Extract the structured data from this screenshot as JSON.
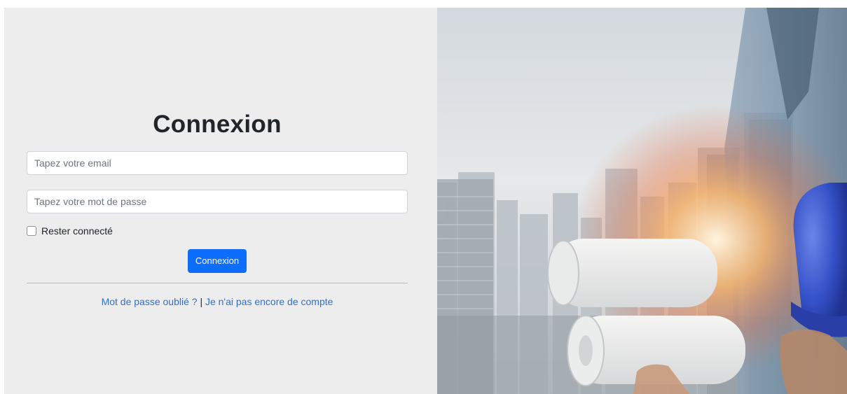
{
  "login": {
    "title": "Connexion",
    "email_placeholder": "Tapez votre email",
    "password_placeholder": "Tapez votre mot de passe",
    "remember_label": "Rester connecté",
    "remember_checked": false,
    "submit_label": "Connexion",
    "forgot_link": "Mot de passe oublié ?",
    "separator": "|",
    "signup_link": "Je n'ai pas encore de compte"
  },
  "colors": {
    "panel_background": "#ededed",
    "primary_button": "#0d6efd",
    "link": "#2f6fd0"
  },
  "hero_image": {
    "subject": "engineer-with-blueprints-and-helmet-over-city-skyline"
  }
}
